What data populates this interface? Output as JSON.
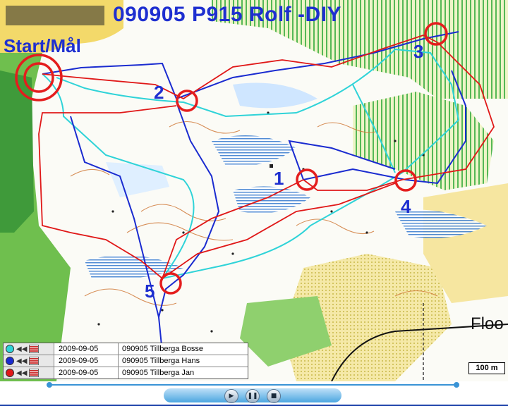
{
  "map": {
    "title": "090905 P915 Rolf -DIY",
    "start_label": "Start/Mål",
    "controls": [
      {
        "number": "1"
      },
      {
        "number": "2"
      },
      {
        "number": "3"
      },
      {
        "number": "4"
      },
      {
        "number": "5"
      }
    ],
    "place_label": "Floo",
    "scale_label": "100 m"
  },
  "runners": [
    {
      "date": "2009-09-05",
      "name": "090905 Tillberga Bosse",
      "color": "#2fd3d8"
    },
    {
      "date": "2009-09-05",
      "name": "090905 Tillberga Hans",
      "color": "#1a2bd0"
    },
    {
      "date": "2009-09-05",
      "name": "090905 Tillberga Jan",
      "color": "#e01818"
    }
  ],
  "playback": {
    "progress": 0.0,
    "buttons": [
      "play-icon",
      "pause-icon",
      "stop-icon"
    ]
  },
  "colors": {
    "control_circle": "#e41d1d",
    "label_blue": "#1e2fd0"
  }
}
